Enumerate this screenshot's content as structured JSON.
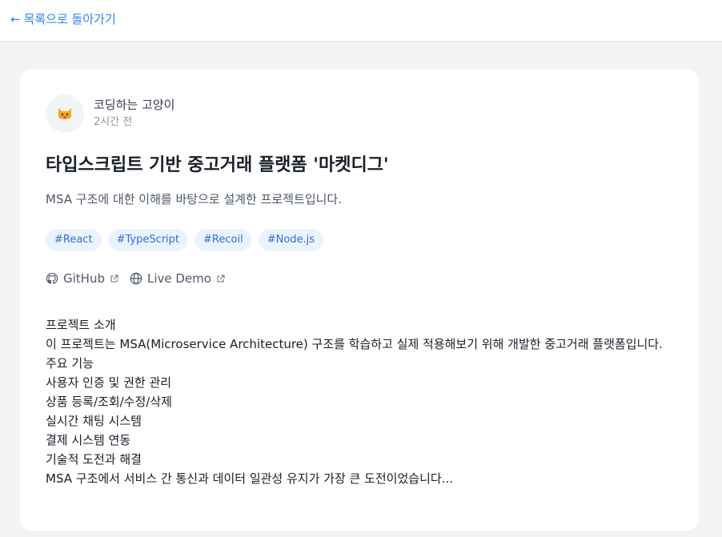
{
  "nav": {
    "back_arrow": "←",
    "back_label": "목록으로 돌아가기"
  },
  "post": {
    "author": {
      "name": "코딩하는 고양이",
      "time": "2시간 전",
      "avatar_icon": "cat-face-icon"
    },
    "title": "타입스크립트 기반 중고거래 플랫폼 '마켓디그'",
    "description": "MSA 구조에 대한 이해를 바탕으로 설계한 프로젝트입니다.",
    "tags": [
      "#React",
      "#TypeScript",
      "#Recoil",
      "#Node.js"
    ],
    "links": {
      "github_label": "GitHub",
      "demo_label": "Live Demo"
    },
    "content": [
      "프로젝트 소개",
      "이 프로젝트는 MSA(Microservice Architecture) 구조를 학습하고 실제 적용해보기 위해 개발한 중고거래 플랫폼입니다.",
      "주요 기능",
      "사용자 인증 및 권한 관리",
      "상품 등록/조회/수정/삭제",
      "실시간 채팅 시스템",
      "결제 시스템 연동",
      "기술적 도전과 해결",
      "MSA 구조에서 서비스 간 통신과 데이터 일관성 유지가 가장 큰 도전이었습니다..."
    ]
  },
  "colors": {
    "accent": "#3182f6",
    "tag_bg": "#ebf3fe",
    "tag_text": "#2c6fdb",
    "page_bg": "#f2f4f6"
  }
}
